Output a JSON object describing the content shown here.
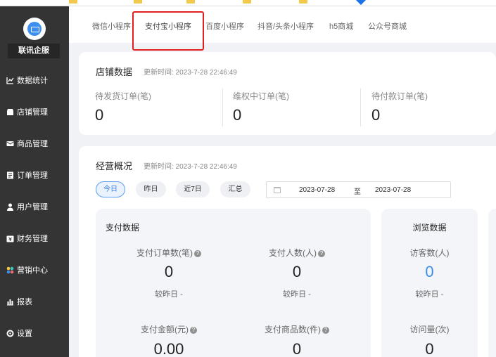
{
  "sidebar": {
    "org_name": "联讯企服",
    "items": [
      {
        "label": "数据统计",
        "icon": "line-chart-icon"
      },
      {
        "label": "店铺管理",
        "icon": "store-icon"
      },
      {
        "label": "商品管理",
        "icon": "mail-icon"
      },
      {
        "label": "订单管理",
        "icon": "order-list-icon"
      },
      {
        "label": "用户管理",
        "icon": "user-icon"
      },
      {
        "label": "财务管理",
        "icon": "finance-icon"
      },
      {
        "label": "营销中心",
        "icon": "marketing-icon"
      },
      {
        "label": "报表",
        "icon": "bar-chart-icon"
      },
      {
        "label": "设置",
        "icon": "settings-icon"
      }
    ]
  },
  "tabs": [
    "微信小程序",
    "支付宝小程序",
    "百度小程序",
    "抖音/头条小程序",
    "h5商城",
    "公众号商城"
  ],
  "active_tab": "支付宝小程序",
  "store_data": {
    "title": "店铺数据",
    "updated": "更新时间: 2023-7-28 22:46:49",
    "stats": [
      {
        "label": "待发货订单(笔)",
        "value": "0"
      },
      {
        "label": "维权中订单(笔)",
        "value": "0"
      },
      {
        "label": "待付款订单(笔)",
        "value": "0"
      }
    ]
  },
  "overview": {
    "title": "经营概况",
    "updated": "更新时间: 2023-7-28 22:46:49",
    "ranges": [
      "今日",
      "昨日",
      "近7日",
      "汇总"
    ],
    "active_range": "今日",
    "date_start": "2023-07-28",
    "date_sep": "至",
    "date_end": "2023-07-28",
    "payment": {
      "title": "支付数据",
      "metrics": [
        {
          "label": "支付订单数(笔)",
          "value": "0",
          "compare": "较昨日 -"
        },
        {
          "label": "支付人数(人)",
          "value": "0",
          "compare": "较昨日 -"
        },
        {
          "label": "支付金额(元)",
          "value": "0.00"
        },
        {
          "label": "支付商品数(件)",
          "value": "0"
        }
      ]
    },
    "browse": {
      "title": "浏览数据",
      "metrics": [
        {
          "label": "访客数(人)",
          "value": "0",
          "compare": "较昨日 -"
        },
        {
          "label": "访问量(次)",
          "value": "0"
        }
      ]
    }
  },
  "colors": {
    "sidebar_bg": "#343434",
    "accent_blue": "#3a8ee6",
    "highlight_red": "#e02020"
  }
}
